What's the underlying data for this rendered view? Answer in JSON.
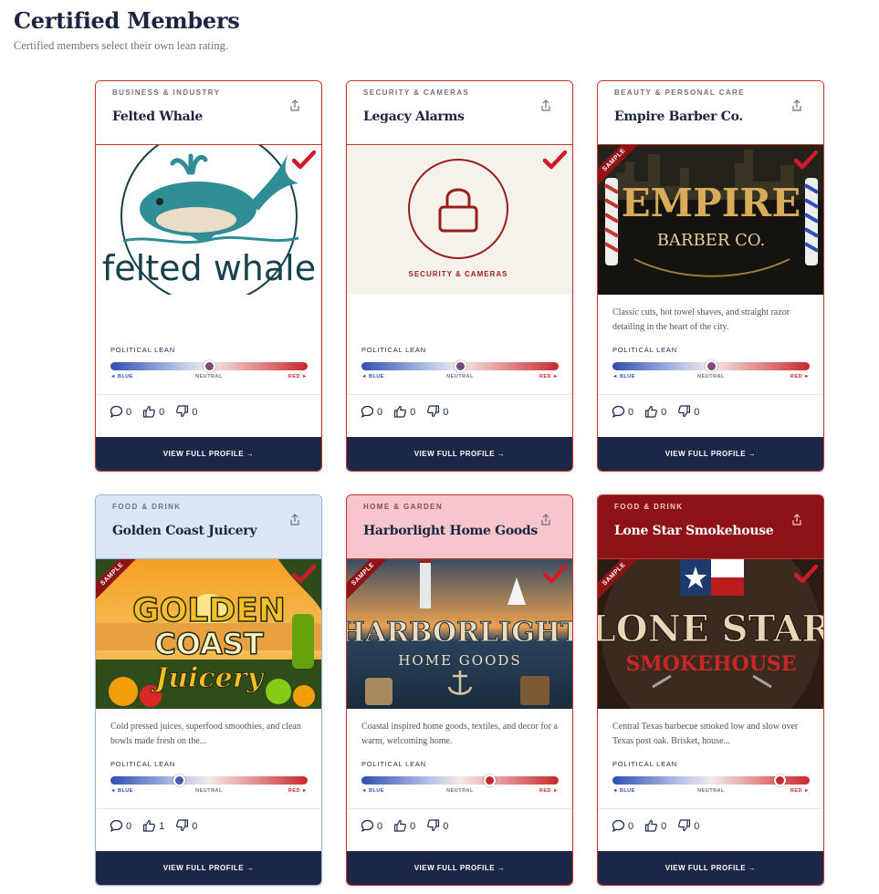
{
  "page": {
    "title": "Certified Members",
    "subtitle": "Certified members select their own lean rating."
  },
  "lean_scale": {
    "label": "POLITICAL LEAN",
    "left": "◄ BLUE",
    "center": "NEUTRAL",
    "right": "RED ►"
  },
  "view_button_label": "VIEW FULL PROFILE →",
  "colors": {
    "navy": "#1c2747",
    "red": "#c0392b",
    "blue": "#2f4fb3"
  },
  "cards": [
    {
      "category": "BUSINESS & INDUSTRY",
      "name": "Felted Whale",
      "description": "",
      "lean": 0.5,
      "comments": "0",
      "likes": "0",
      "dislikes": "0",
      "logo_text": "felted whale",
      "sample": false
    },
    {
      "category": "SECURITY & CAMERAS",
      "name": "Legacy Alarms",
      "description": "",
      "lean": 0.5,
      "comments": "0",
      "likes": "0",
      "dislikes": "0",
      "logo_text": "SECURITY & CAMERAS",
      "sample": false
    },
    {
      "category": "BEAUTY & PERSONAL CARE",
      "name": "Empire Barber Co.",
      "description": "Classic cuts, hot towel shaves, and straight razor detailing in the heart of the city.",
      "lean": 0.5,
      "comments": "0",
      "likes": "0",
      "dislikes": "0",
      "logo_text": "EMPIRE",
      "logo_sub": "BARBER CO.",
      "sample": true,
      "sample_label": "SAMPLE"
    },
    {
      "category": "FOOD & DRINK",
      "name": "Golden Coast Juicery",
      "description": "Cold pressed juices, superfood smoothies, and clean bowls made fresh on the...",
      "lean": 0.35,
      "comments": "0",
      "likes": "1",
      "dislikes": "0",
      "logo_text": "GOLDEN",
      "logo_sub": "COAST",
      "logo_sub2": "Juicery",
      "sample": true,
      "sample_label": "SAMPLE"
    },
    {
      "category": "HOME & GARDEN",
      "name": "Harborlight Home Goods",
      "description": "Coastal inspired home goods, textiles, and decor for a warm, welcoming home.",
      "lean": 0.65,
      "comments": "0",
      "likes": "0",
      "dislikes": "0",
      "logo_text": "HARBORLIGHT",
      "logo_sub": "HOME GOODS",
      "sample": true,
      "sample_label": "SAMPLE"
    },
    {
      "category": "FOOD & DRINK",
      "name": "Lone Star Smokehouse",
      "description": "Central Texas barbecue smoked low and slow over Texas post oak. Brisket, house...",
      "lean": 0.85,
      "comments": "0",
      "likes": "0",
      "dislikes": "0",
      "logo_text": "LONE STAR",
      "logo_sub": "SMOKEHOUSE",
      "sample": true,
      "sample_label": "SAMPLE"
    }
  ]
}
